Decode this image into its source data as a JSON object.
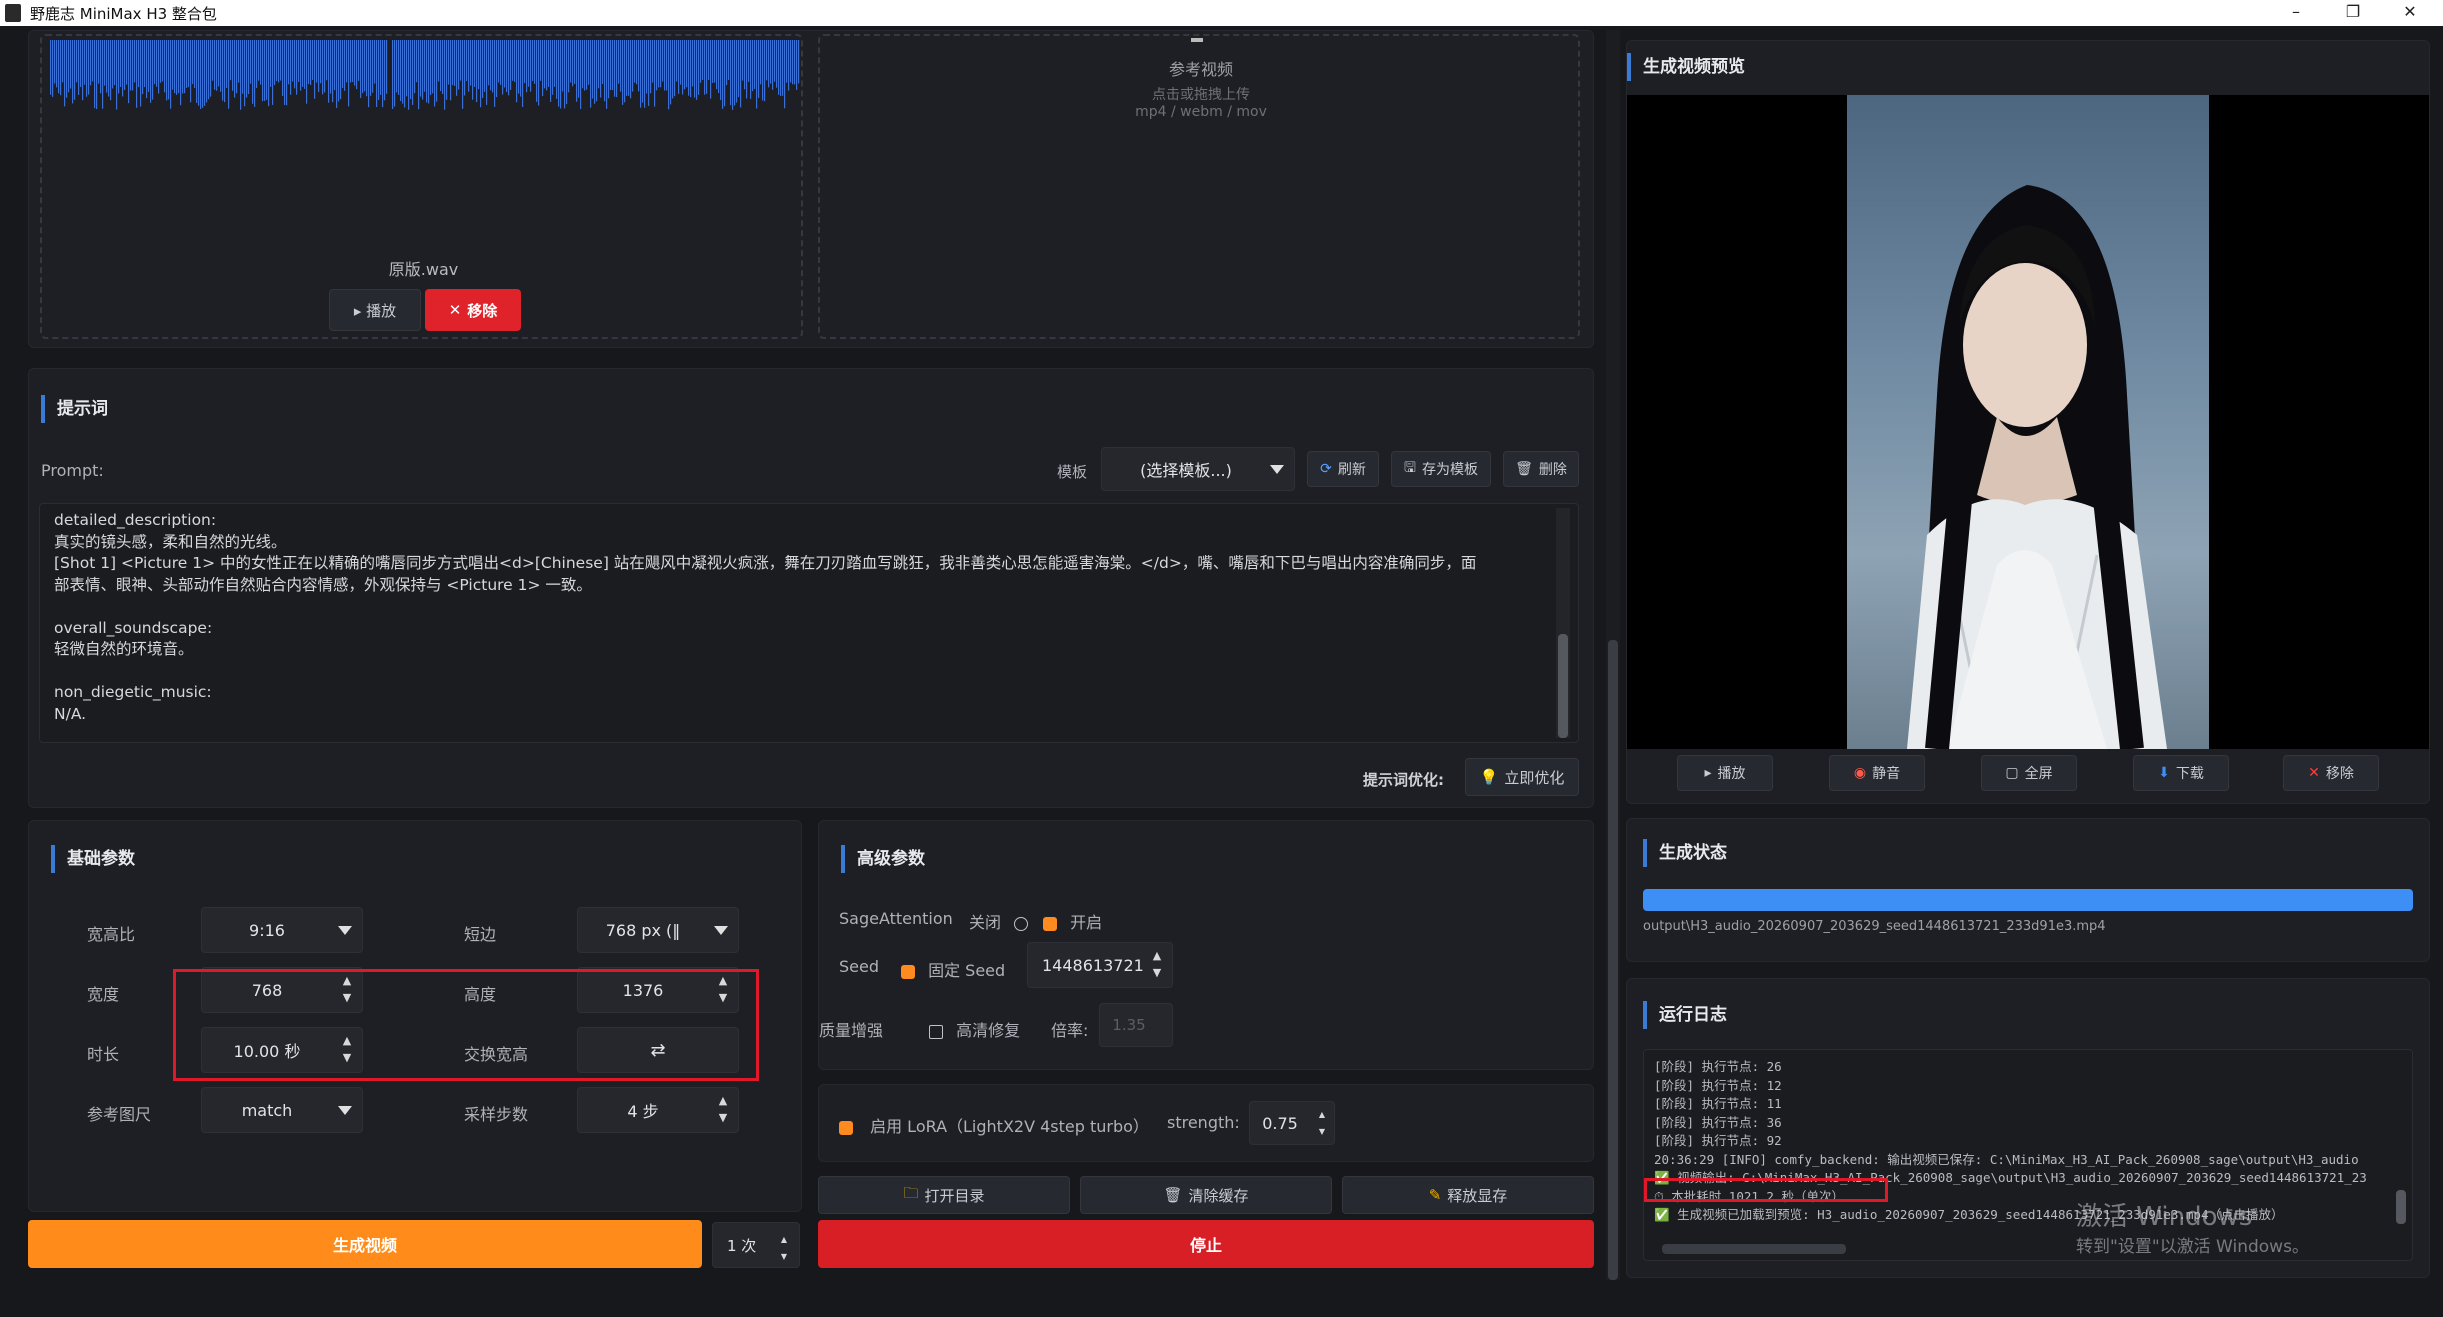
{
  "window": {
    "title": "野鹿志 MiniMax H3 整合包",
    "minimize": "–",
    "restore": "❐",
    "close": "✕"
  },
  "audio": {
    "filename": "原版.wav",
    "play": "▸ 播放",
    "remove": "移除"
  },
  "ref_video": {
    "label": "参考视频",
    "hint": "点击或拖拽上传",
    "formats": "mp4 / webm / mov"
  },
  "prompt": {
    "section": "提示词",
    "label": "Prompt:",
    "template_label": "模板",
    "template_value": "(选择模板...)",
    "refresh": "刷新",
    "save_template": "存为模板",
    "delete": "删除",
    "lines": [
      "detailed_description:",
      "真实的镜头感，柔和自然的光线。",
      "[Shot 1] <Picture 1> 中的女性正在以精确的嘴唇同步方式唱出<d>[Chinese] 站在飓风中凝视火疯涨，舞在刀刃踏血写跳狂，我非善类心思怎能遥害海棠。</d>，嘴、嘴唇和下巴与唱出内容准确同步，面",
      "部表情、眼神、头部动作自然贴合内容情感，外观保持与 <Picture 1> 一致。",
      "",
      "overall_soundscape:",
      "轻微自然的环境音。",
      "",
      "non_diegetic_music:",
      "N/A."
    ],
    "optimize_label": "提示词优化:",
    "optimize_button": "立即优化"
  },
  "basic": {
    "section": "基础参数",
    "aspect_label": "宽高比",
    "aspect_value": "9:16",
    "short_label": "短边",
    "short_value": "768 px (‖",
    "width_label": "宽度",
    "width_value": "768",
    "height_label": "高度",
    "height_value": "1376",
    "duration_label": "时长",
    "duration_value": "10.00 秒",
    "swap_label": "交换宽高",
    "swap_icon": "⇄",
    "ref_size_label": "参考图尺",
    "ref_size_value": "match",
    "steps_label": "采样步数",
    "steps_value": "4 步"
  },
  "advanced": {
    "section": "高级参数",
    "sage_label": "SageAttention",
    "sage_off": "关闭",
    "sage_on": "开启",
    "seed_label": "Seed",
    "fixed_seed": "固定 Seed",
    "seed_value": "1448613721",
    "quality_label": "质量增强",
    "hd_fix": "高清修复",
    "ratio_label": "倍率:",
    "ratio_value": "1.35"
  },
  "lora": {
    "label": "启用 LoRA（LightX2V 4step turbo）",
    "strength_label": "strength:",
    "strength_value": "0.75"
  },
  "actions": {
    "open_dir": "打开目录",
    "clear_cache": "清除缓存",
    "free_vram": "释放显存",
    "generate": "生成视频",
    "count": "1 次",
    "stop": "停止"
  },
  "preview": {
    "section": "生成视频预览",
    "play": "播放",
    "mute": "静音",
    "fullscreen": "全屏",
    "download": "下载",
    "remove": "移除"
  },
  "status": {
    "section": "生成状态",
    "progress": 1.0,
    "path": "output\\H3_audio_20260907_203629_seed1448613721_233d91e3.mp4"
  },
  "log": {
    "section": "运行日志",
    "lines": [
      "[阶段] 执行节点: 26",
      "[阶段] 执行节点: 12",
      "[阶段] 执行节点: 11",
      "[阶段] 执行节点: 36",
      "[阶段] 执行节点: 92",
      "20:36:29 [INFO] comfy_backend: 输出视频已保存: C:\\MiniMax_H3_AI_Pack_260908_sage\\output\\H3_audio",
      "✅ 视频输出: C:\\MiniMax_H3_AI_Pack_260908_sage\\output\\H3_audio_20260907_203629_seed1448613721_23",
      "⏱ 本批耗时 1021.2 秒（单次）",
      "✅ 生成视频已加载到预览: H3_audio_20260907_203629_seed1448613721_233d91e3.mp4（点击播放）"
    ]
  },
  "watermark": {
    "line1": "激活 Windows",
    "line2": "转到\"设置\"以激活 Windows。"
  },
  "colors": {
    "accent": "#3a7bd5",
    "orange": "#ff8a1f",
    "red": "#d81f26",
    "progress": "#3d8ef5"
  }
}
